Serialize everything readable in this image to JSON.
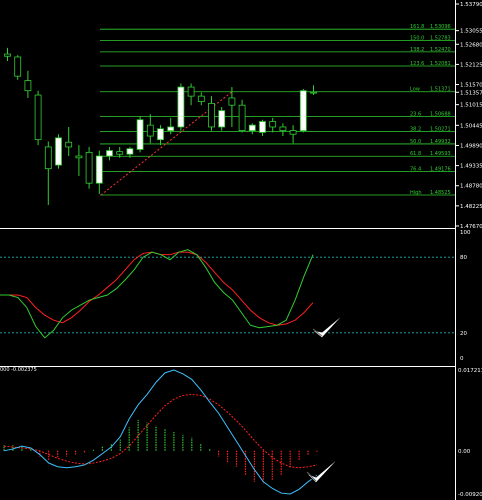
{
  "colors": {
    "background": "#000000",
    "grid_frame": "#ffffff",
    "candle_border": "#32cd32",
    "bull_body": "#ffffff",
    "bear_body": "#000000",
    "fib_level": "#2fcf2f",
    "fib_trend": "#ff3030",
    "stoch_main": "#32cd32",
    "stoch_signal": "#ff2020",
    "stoch_level": "#20b0b0",
    "macd_line": "#40c0ff",
    "macd_signal": "#ff2020",
    "macd_hist_pos": "#32cd32",
    "macd_hist_neg": "#ff2020",
    "checkmark": "#ffffff"
  },
  "price_panel": {
    "axis_labels": [
      "1.53790",
      "1.53055",
      "1.52680",
      "1.52125",
      "1.51570",
      "1.51357",
      "1.51015",
      "1.50445",
      "1.49890",
      "1.49335",
      "1.48780",
      "1.48225",
      "1.47670"
    ],
    "fib_levels": [
      {
        "name": "161.8",
        "value": "1.53096"
      },
      {
        "name": "150.0",
        "value": "1.52783"
      },
      {
        "name": "138.2",
        "value": "1.52470"
      },
      {
        "name": "123.6",
        "value": "1.52081"
      },
      {
        "name": "Low",
        "value": "1.51371"
      },
      {
        "name": "23.6",
        "value": "1.50688"
      },
      {
        "name": "38.2",
        "value": "1.50271"
      },
      {
        "name": "50.0",
        "value": "1.49932"
      },
      {
        "name": "61.8",
        "value": "1.49593"
      },
      {
        "name": "76.4",
        "value": "1.49176"
      },
      {
        "name": "High",
        "value": "1.48525"
      }
    ],
    "candles": [
      {
        "o": 1.5241,
        "h": 1.5258,
        "l": 1.5222,
        "c": 1.5235
      },
      {
        "o": 1.5233,
        "h": 1.5238,
        "l": 1.517,
        "c": 1.518
      },
      {
        "o": 1.5168,
        "h": 1.5195,
        "l": 1.512,
        "c": 1.514
      },
      {
        "o": 1.5128,
        "h": 1.514,
        "l": 1.499,
        "c": 1.5005
      },
      {
        "o": 1.4985,
        "h": 1.5,
        "l": 1.4825,
        "c": 1.4925
      },
      {
        "o": 1.4935,
        "h": 1.502,
        "l": 1.4925,
        "c": 1.501
      },
      {
        "o": 1.4998,
        "h": 1.504,
        "l": 1.496,
        "c": 1.4985
      },
      {
        "o": 1.496,
        "h": 1.499,
        "l": 1.4905,
        "c": 1.4955
      },
      {
        "o": 1.497,
        "h": 1.4985,
        "l": 1.487,
        "c": 1.4885
      },
      {
        "o": 1.4885,
        "h": 1.4975,
        "l": 1.4855,
        "c": 1.496
      },
      {
        "o": 1.496,
        "h": 1.4985,
        "l": 1.4948,
        "c": 1.4975
      },
      {
        "o": 1.4972,
        "h": 1.4985,
        "l": 1.4955,
        "c": 1.4965
      },
      {
        "o": 1.4965,
        "h": 1.4985,
        "l": 1.4955,
        "c": 1.498
      },
      {
        "o": 1.4978,
        "h": 1.507,
        "l": 1.497,
        "c": 1.506
      },
      {
        "o": 1.5045,
        "h": 1.5075,
        "l": 1.4995,
        "c": 1.5015
      },
      {
        "o": 1.5005,
        "h": 1.5045,
        "l": 1.499,
        "c": 1.5035
      },
      {
        "o": 1.503,
        "h": 1.5065,
        "l": 1.502,
        "c": 1.504
      },
      {
        "o": 1.504,
        "h": 1.516,
        "l": 1.503,
        "c": 1.515
      },
      {
        "o": 1.515,
        "h": 1.516,
        "l": 1.51,
        "c": 1.5125
      },
      {
        "o": 1.5125,
        "h": 1.5135,
        "l": 1.51,
        "c": 1.511
      },
      {
        "o": 1.5105,
        "h": 1.5125,
        "l": 1.503,
        "c": 1.504
      },
      {
        "o": 1.504,
        "h": 1.5095,
        "l": 1.503,
        "c": 1.5085
      },
      {
        "o": 1.512,
        "h": 1.515,
        "l": 1.504,
        "c": 1.51
      },
      {
        "o": 1.51,
        "h": 1.5115,
        "l": 1.5025,
        "c": 1.503
      },
      {
        "o": 1.503,
        "h": 1.505,
        "l": 1.502,
        "c": 1.5045
      },
      {
        "o": 1.5025,
        "h": 1.506,
        "l": 1.5015,
        "c": 1.5055
      },
      {
        "o": 1.5055,
        "h": 1.5065,
        "l": 1.5025,
        "c": 1.504
      },
      {
        "o": 1.504,
        "h": 1.505,
        "l": 1.5015,
        "c": 1.503
      },
      {
        "o": 1.503,
        "h": 1.5045,
        "l": 1.4995,
        "c": 1.502
      },
      {
        "o": 1.503,
        "h": 1.5145,
        "l": 1.5025,
        "c": 1.514
      },
      {
        "o": 1.5136,
        "h": 1.5155,
        "l": 1.5128,
        "c": 1.5134
      }
    ]
  },
  "stochastic_panel": {
    "axis_labels": [
      "100",
      "80",
      "20",
      "0"
    ],
    "levels": [
      80,
      20
    ],
    "main": [
      50,
      50,
      48,
      40,
      25,
      16,
      22,
      32,
      38,
      42,
      46,
      48,
      50,
      55,
      62,
      70,
      80,
      84,
      82,
      78,
      84,
      86,
      82,
      72,
      60,
      52,
      46,
      36,
      26,
      24,
      25,
      26,
      30,
      46,
      65,
      82
    ],
    "signal": [
      50,
      50,
      50,
      48,
      40,
      34,
      30,
      28,
      32,
      38,
      45,
      50,
      56,
      62,
      70,
      78,
      83,
      84,
      82,
      82,
      84,
      84,
      82,
      76,
      68,
      60,
      54,
      46,
      38,
      32,
      28,
      26,
      27,
      30,
      36,
      44
    ]
  },
  "macd_panel": {
    "header": "000 -0.002375",
    "axis_labels": [
      "0.017211",
      "0.00",
      "-0.00920"
    ],
    "range": [
      -0.0092,
      0.017211
    ],
    "histogram": [
      0.0012,
      0.0012,
      0.0008,
      0.0004,
      -0.0012,
      -0.002,
      -0.0016,
      -0.0012,
      -0.0008,
      -0.0004,
      0.0002,
      0.001,
      0.0016,
      0.0024,
      0.005,
      0.0066,
      0.006,
      0.0054,
      0.0048,
      0.004,
      0.0034,
      0.0028,
      0.0016,
      0.0004,
      -0.0012,
      -0.0024,
      -0.0034,
      -0.0052,
      -0.0066,
      -0.007,
      -0.0062,
      -0.0052,
      -0.0036,
      -0.002,
      -0.001,
      -0.0002
    ],
    "macd": [
      0.0,
      0.0004,
      0.001,
      0.0006,
      -0.0008,
      -0.0026,
      -0.0034,
      -0.0036,
      -0.0034,
      -0.003,
      -0.002,
      -0.0006,
      0.0008,
      0.003,
      0.0068,
      0.0098,
      0.012,
      0.0146,
      0.0166,
      0.0172,
      0.0164,
      0.0152,
      0.013,
      0.0104,
      0.008,
      0.005,
      0.002,
      -0.001,
      -0.004,
      -0.0066,
      -0.008,
      -0.009,
      -0.0092,
      -0.0082,
      -0.0066,
      -0.0052
    ],
    "signal": [
      0.001,
      0.0008,
      0.0006,
      0.0004,
      0.0,
      -0.0008,
      -0.0016,
      -0.0022,
      -0.0026,
      -0.0028,
      -0.0026,
      -0.0022,
      -0.0016,
      -0.0006,
      0.001,
      0.0032,
      0.0054,
      0.0076,
      0.0096,
      0.011,
      0.0118,
      0.012,
      0.0118,
      0.011,
      0.0098,
      0.0082,
      0.0064,
      0.0044,
      0.0022,
      0.0002,
      -0.0014,
      -0.0026,
      -0.0034,
      -0.0036,
      -0.0034,
      -0.003
    ]
  }
}
